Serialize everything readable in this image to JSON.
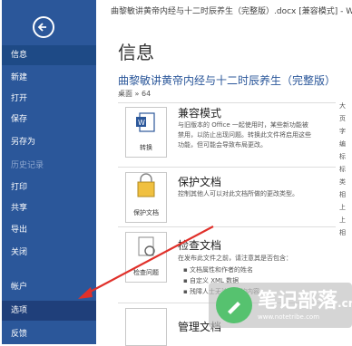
{
  "window_title": "曲黎敏讲黄帝内经与十二时辰养生（完整版）.docx [兼容模式] - Word",
  "sidebar": {
    "items": [
      {
        "label": "信息"
      },
      {
        "label": "新建"
      },
      {
        "label": "打开"
      },
      {
        "label": "保存"
      },
      {
        "label": "另存为"
      },
      {
        "label": "历史记录"
      },
      {
        "label": "打印"
      },
      {
        "label": "共享"
      },
      {
        "label": "导出"
      },
      {
        "label": "关闭"
      },
      {
        "label": "帐户"
      },
      {
        "label": "选项"
      },
      {
        "label": "反馈"
      }
    ]
  },
  "main": {
    "title": "信息",
    "doc_title": "曲黎敏讲黄帝内经与十二时辰养生（完整版）",
    "path": "桌面 » 64",
    "sections": [
      {
        "button_label": "转换",
        "title": "兼容模式",
        "desc": "与旧版本的 Office 一起使用时，某些新功能被禁用，以防止出现问题。转换此文件将启用这些功能，但可能会导致布局更改。"
      },
      {
        "button_label": "保护文档",
        "title": "保护文档",
        "desc": "控制其他人可以对此文档所做的更改类型。"
      },
      {
        "button_label": "检查问题",
        "title": "检查文档",
        "desc": "在发布此文件之前，请注意其是否包含：",
        "bullets": [
          "文档属性和作者的姓名",
          "自定义 XML 数据",
          "残障人士无法阅读的内容"
        ]
      },
      {
        "button_label": "管理文档",
        "title": "管理文档"
      }
    ],
    "right_column": [
      "大",
      "页",
      "字",
      "编",
      "标",
      "标",
      "类",
      "相",
      "上",
      "上",
      "相"
    ]
  },
  "watermark": {
    "text": "笔记部落",
    "suffix": ".cn",
    "url": "www.notetribe.com"
  }
}
